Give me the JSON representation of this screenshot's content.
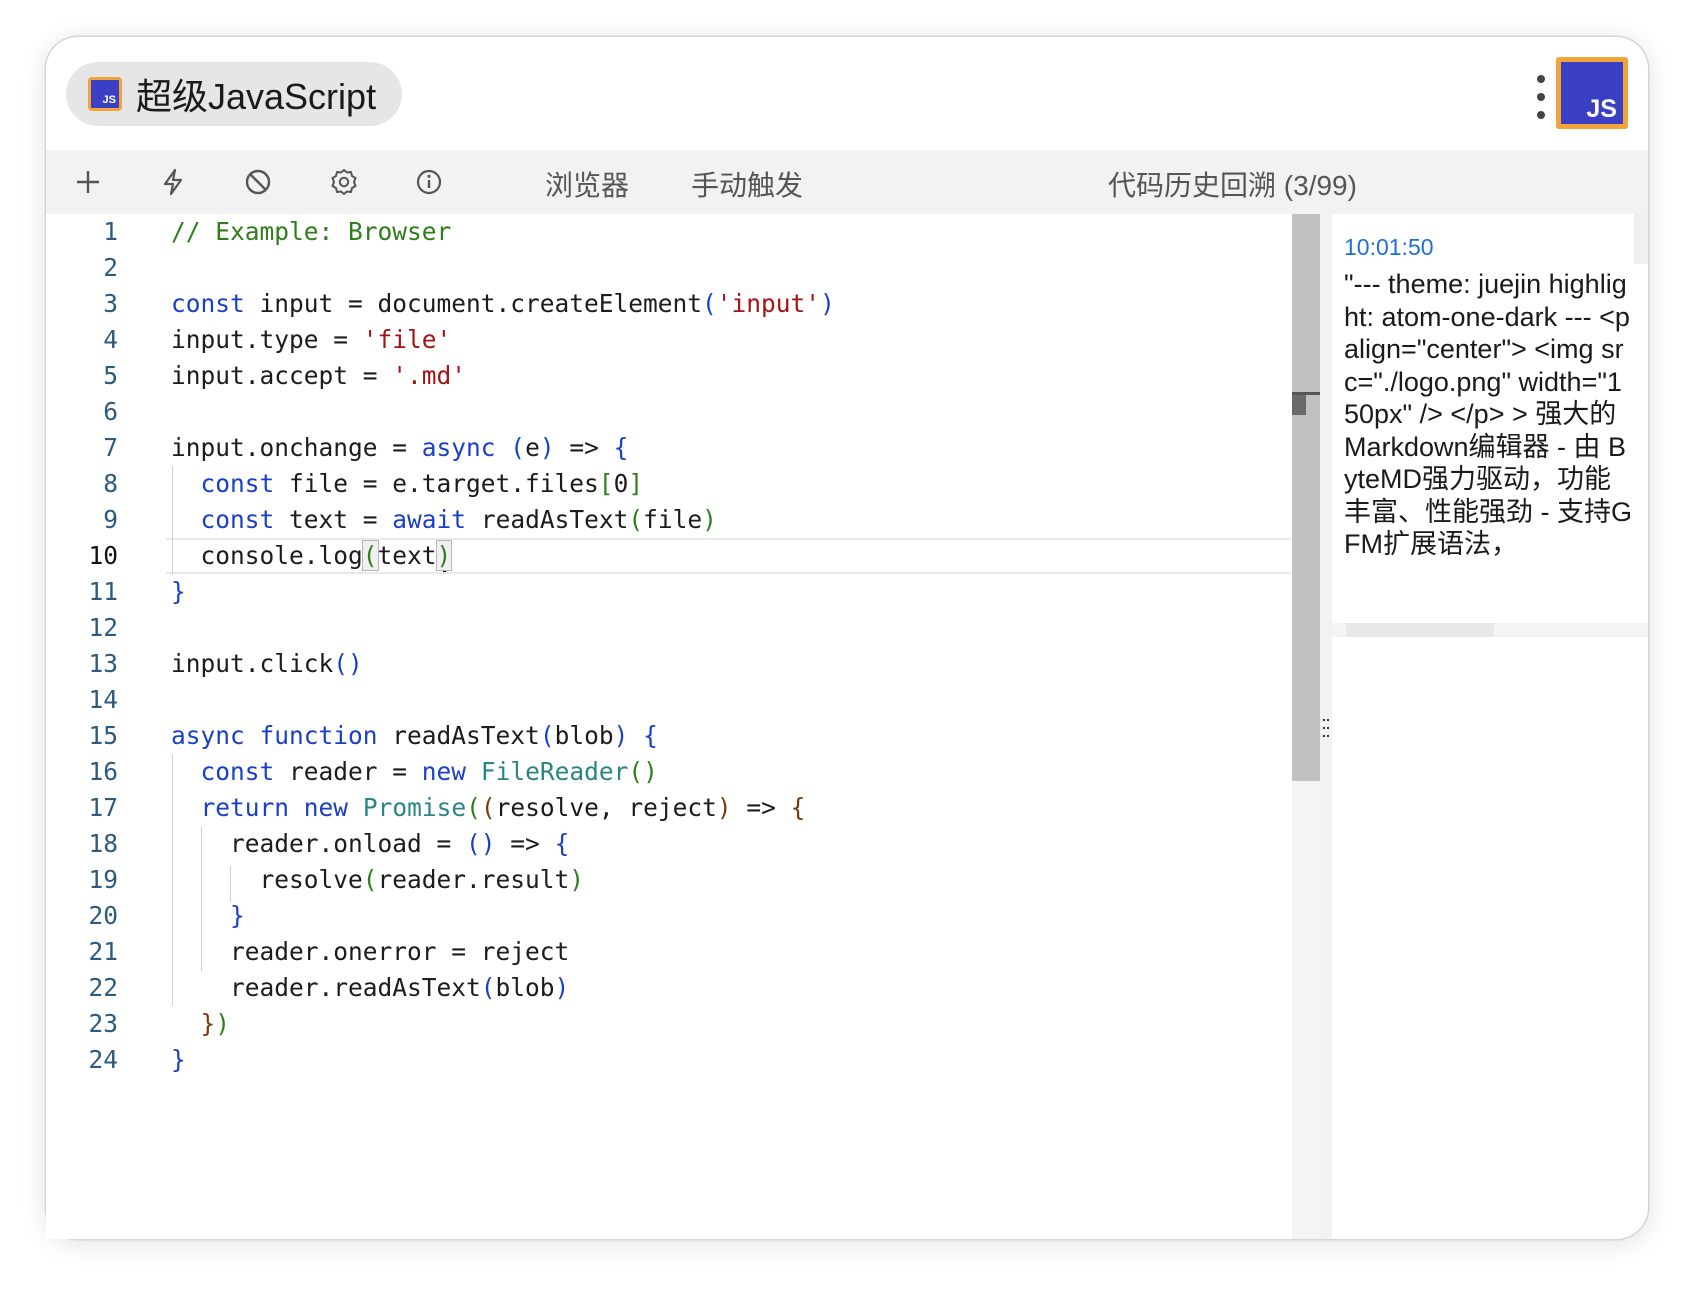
{
  "app": {
    "title": "超级JavaScript",
    "icon_label": "JS",
    "avatar_label": "JS"
  },
  "toolbar": {
    "icons": [
      "plus-icon",
      "lightning-icon",
      "block-icon",
      "gear-icon",
      "info-icon"
    ],
    "browser_label": "浏览器",
    "manual_trigger_label": "手动触发",
    "history_label": "代码历史回溯 (3/99)"
  },
  "editor": {
    "active_line": 10,
    "line_numbers": [
      "1",
      "2",
      "3",
      "4",
      "5",
      "6",
      "7",
      "8",
      "9",
      "10",
      "11",
      "12",
      "13",
      "14",
      "15",
      "16",
      "17",
      "18",
      "19",
      "20",
      "21",
      "22",
      "23",
      "24"
    ],
    "lines": [
      "// Example: Browser",
      "",
      "const input = document.createElement('input')",
      "input.type = 'file'",
      "input.accept = '.md'",
      "",
      "input.onchange = async (e) => {",
      "  const file = e.target.files[0]",
      "  const text = await readAsText(file)",
      "  console.log(text)",
      "}",
      "",
      "input.click()",
      "",
      "async function readAsText(blob) {",
      "  const reader = new FileReader()",
      "  return new Promise((resolve, reject) => {",
      "    reader.onload = () => {",
      "      resolve(reader.result)",
      "    }",
      "    reader.onerror = reject",
      "    reader.readAsText(blob)",
      "  })",
      "}"
    ]
  },
  "console": {
    "timestamp": "10:01:50",
    "output": "\"--- theme: juejin highlight: atom-one-dark --- <p align=\"center\"> <img src=\"./logo.png\" width=\"150px\" /> </p> > 强大的 Markdown编辑器 - 由 ByteMD强力驱动，功能丰富、性能强劲 - 支持GFM扩展语法，"
  },
  "colors": {
    "keyword": "#1a3fc8",
    "string": "#a31515",
    "comment": "#2f7d1b",
    "class": "#2a8585",
    "timestamp": "#1e6fd6",
    "icon_border": "#f2a33a",
    "icon_bg": "#3a3fc4"
  }
}
